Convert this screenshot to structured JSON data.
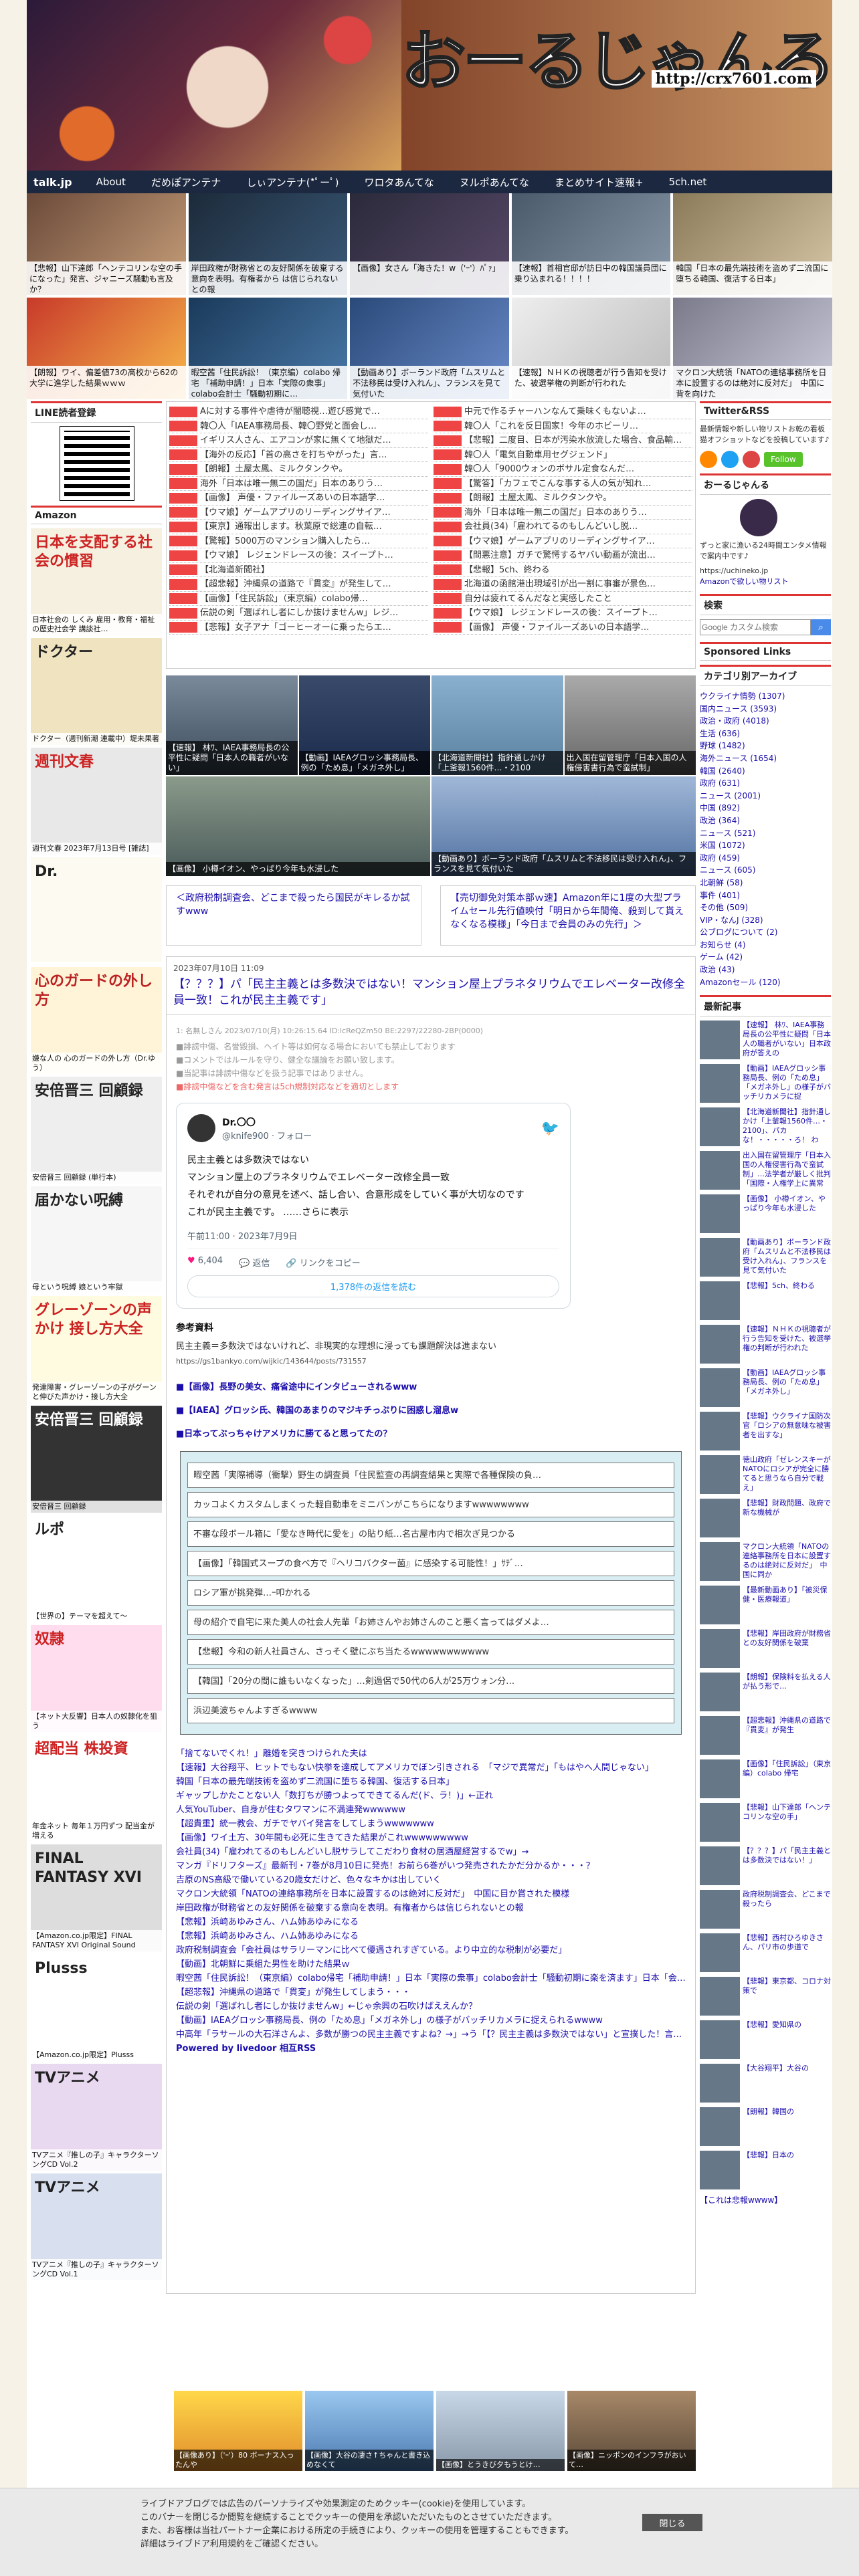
{
  "site": {
    "title": "おーるじゃんる",
    "url": "http://crx7601.com"
  },
  "nav": [
    "talk.jp",
    "About",
    "だめぽアンテナ",
    "しぃアンテナ(*ﾟーﾟ)",
    "ワロタあんてな",
    "ヌルポあんてな",
    "まとめサイト速報+",
    "5ch.net"
  ],
  "top_thumbs": [
    "【悲報】山下達郎「ヘンテコリンな空の手になった」発言、ジャニーズ騒動も言及か？",
    "岸田政権が財務省との友好関係を破棄する意向を表明。有権者から は信じられないとの報",
    "【画像】女さん「海きた！w（'ｰ'）ﾊﾟｧ」",
    "【速報】首相官邸が訪日中の韓国議員団に乗り込まれる！！！！",
    "韓国「日本の最先端技術を盗めず二流国に堕ちる韓国、復活する日本」",
    "【朗報】ワイ、偏差値73の高校から62の大学に進学した結果ｗｗｗ",
    "暇空茜「住民訴訟！（東京編）colabo 帰宅 「補助申請！」日本「実際の衆事」 colabo会計士「騒動初期に…",
    "【動画あり】ボーランド政府「ムスリムと不法移民は受け入れん」、フランスを見て気付いた",
    "【速報】ＮＨＫの視聴者が行う告知を受けた、被選挙権の判断が行われた",
    "マクロン大統領「NATOの連絡事務所を日本に設置するのは絶対に反対だ」　中国に背を向けた"
  ],
  "left_sidebar": {
    "line_heading": "LINE読者登録",
    "amazon_heading": "Amazon",
    "books": [
      {
        "title": "日本を支配する社会の慣習",
        "caption": "日本社会の しくみ 雇用・教育・福祉の歴史社会学 講談社…"
      },
      {
        "title": "ドクター",
        "caption": "ドクター（週刊新潮 連載中）堤未果著"
      },
      {
        "title": "週刊文春",
        "caption": "週刊文春 2023年7月13日号 [雑誌]"
      },
      {
        "title": "Dr.",
        "caption": ""
      },
      {
        "title": "心のガードの外し方",
        "caption": "嫌な人の 心のガードの外し方（Dr.ゆう）"
      },
      {
        "title": "安倍晋三 回顧録",
        "caption": "安倍晋三 回顧録 (単行本)"
      },
      {
        "title": "届かない呪縛",
        "caption": "母という呪縛 娘という牢獄"
      },
      {
        "title": "グレーゾーンの声かけ 接し方大全",
        "caption": "発達障害・グレーゾーンの子がグーンと伸びた声かけ・接し方大全"
      },
      {
        "title": "安倍晋三 回顧録",
        "caption": "安倍晋三 回顧録"
      },
      {
        "title": "ルポ",
        "caption": "【世界の】テーマを超えて〜"
      },
      {
        "title": "奴隷",
        "caption": "【ネット大反響】日本人の奴隷化を狙う"
      },
      {
        "title": "超配当 株投資",
        "caption": "年金ネット 毎年１万円ずつ 配当金が増える"
      },
      {
        "title": "FINAL FANTASY XVI",
        "caption": "【Amazon.co.jp限定】FINAL FANTASY XVI Original Sound"
      },
      {
        "title": "Plusss",
        "caption": "【Amazon.co.jp限定】Plusss"
      },
      {
        "title": "TVアニメ",
        "caption": "TVアニメ『推しの子』キャラクターソングCD Vol.2"
      },
      {
        "title": "TVアニメ",
        "caption": "TVアニメ『推しの子』キャラクターソングCD Vol.1"
      }
    ]
  },
  "links_left": [
    "Aに対する事件や虐待が闇聴視…遊び感覚で…",
    "韓〇人「IAEA事務局長、韓〇野党と面会し…",
    "イギリス人さん、エアコンが家に無くて地獄だ…",
    "【海外の反応】「首の高さを打ちやがった」言…",
    "【朗報】土屋太鳳、ミルクタンクや。",
    "海外「日本は唯一無二の国だ」日本のありう…",
    "【画像】 声優・ファイルーズあいの日本語学…",
    "【ウマ娘】ゲームアプリのリーディングサイア…",
    "【東京】通報出します。秋葉原で総連の自転…",
    "【驚報】5000万のマンション購入したら…",
    "【ウマ娘】 レジェンドレースの後：スイープト…",
    "【北海道新聞社】",
    "【超悲報】沖縄県の道路で『貫変』が発生して…",
    "【画像】「住民訴訟」（東京編）colabo帰…",
    "伝説の剣「選ばれし者にしか抜けませんw」レジ…",
    "【悲報】女子アナ「ゴーヒーオーに乗ったらエ…"
  ],
  "links_right": [
    "中元で作るチャーハンなんて乗味くもないよ…",
    "韓〇人「これを反日国家！今年のホビーリ…",
    "【悲報】二度目、日本が汚染水放流した場合、食品輸…",
    "韓〇人「電気自動車用セグジェンド」",
    "韓〇人「9000ウォンのボサル定食なんだ…",
    "【驚答】「カフェでこんな事する人の気が知れ…",
    "【朗報】土屋太鳳、ミルクタンクや。",
    "海外「日本は唯一無二の国だ」日本のありう…",
    "会社員(34)「雇われてるのもしんどいし脱…",
    "【ウマ娘】ゲームアプリのリーディングサイア…",
    "【問悪注意】ガチで驚愕するヤバい動画が流出…",
    "【悲報】5ch、終わる",
    "北海道の函館港出現域引が出一割に事審が景色…",
    "自分は疲れてるんだなと実感したこと",
    "【ウマ娘】 レジェンドレースの後：スイープト…",
    "【画像】 声優・ファイルーズあいの日本語学…"
  ],
  "featured": [
    "【速報】 林ﾜ、IAEA事務局長の公平性に疑問「日本人の職者がいない」",
    "【動画】IAEAグロッシ事務局長、例の「ため息」「メガネ外し」",
    "【北海道新聞社】指針通しかけ「上釜報1560件…・2100",
    "出入国在留管理庁「日本入国の人権侵害書行為で蛮試制」",
    "【画像】 小樽イオン、やっぱり今年も水浸した",
    "【動画あり】ボーランド政府「ムスリムと不法移民は受け入れん」、フランスを見て気付いた"
  ],
  "pager": {
    "prev": "＜政府税制調査会、どこまで殺ったら国民がキレるか試すwww",
    "next": "【売切御免対策本部ｗ速】Amazon年に1度の大型プライムセール先行値映付「明日から年間俺、殺到して貰えなくなる模様」「今日まで会員のみの先行」＞"
  },
  "article": {
    "date": "2023年07月10日 11:09",
    "title": "【？？？】パ「民主主義とは多数決ではない！マンション屋上プラネタリウムでエレベーター改修全員一致！これが民主主義です」",
    "meta": "1: 名無しさん 2023/07/10(月) 10:26:15.64 ID:lcReQZm50 BE:2297/22280-2BP(0000)",
    "notes": [
      "■誹謗中傷、名誉毀損、ヘイト等は如何なる場合においても禁止しております",
      "■コメントではルールを守り、健全な議論をお願い致します。",
      "■当記事は誹謗中傷などを扱う記事ではありません。",
      "■誹謗中傷などを含む発言は5ch規制対応などを適切とします"
    ],
    "tweet": {
      "name": "Dr.〇〇",
      "handle": "@knife900 · フォロー",
      "lines": [
        "民主主義とは多数決ではない",
        "マンション屋上のプラネタリウムでエレベーター改修全員一致",
        "それぞれが自分の意見を述べ、話し合い、合意形成をしていく事が大切なのです",
        "これが民主主義です。 ……さらに表示"
      ],
      "time": "午前11:00 · 2023年7月9日",
      "likes": "6,404",
      "reply": "返信",
      "copy": "リンクをコピー",
      "more": "1,378件の返信を読む"
    },
    "ref_heading": "参考資料",
    "ref_title": "民主主義＝多数決ではないけれど、非現実的な理想に浸っても課題解決は進まない",
    "ref_url": "https://gs1bankyo.com/wijkic/143644/posts/731557",
    "ref_links": [
      "■【画像】長野の美女、痛省途中にインタビューされるwww",
      "■【IAEA】グロッシ氏、韓国のあまりのマジキチっぷりに困惑し溜息w",
      "■日本ってぶっちゃけアメリカに勝てると思ってたの？"
    ],
    "related": [
      "暇空茜「実際補導（衝撃）野生の調査員「住民監査の再調査結果と実際で各種保険の負…",
      "カッコよくカスタムしまくった軽自動車をミニバンがこちらになりますwwwwwwww",
      "不審な段ボール箱に「愛なき時代に愛を」の貼り紙…名古屋市内で相次ぎ見つかる",
      "【画像】「韓国式スープの食べ方で『ヘリコバクター菌』に感染する可能性！」ｻﾃﾞ…",
      "ロシア軍が挑発弾…ｰ叩かれる",
      "母の紹介で自宅に来た美人の社会人先輩「お姉さんやお姉さんのこと悪く言ってはダメよ…",
      "【悲報】今和の新人社員さん、さっそく壁にぶち当たるwwwwwwwwwww",
      "【韓国】「20分の間に誰もいなくなった」…剣過侶で50代の6人が25万ウォン分…",
      "浜辺美波ちゃんよすぎるwwww"
    ],
    "news": [
      "「捨てないでくれ！」離婚を突きつけられた夫は",
      "【速報】大谷翔平、ヒットでもない快挙を達成してアメリカでぼン引きされる　「マジで異常だ」「もはやへ人間じゃない」",
      "韓国「日本の最先端技術を盗めず二流国に堕ちる韓国、復活する日本」",
      "ギャップしかたことない人「数打ちが勝つよってできてるんだ(ド、ラ！)」←正れ",
      "人気YouTuber、自身が住むタワマンに不満連発wwwwww",
      "【超貴重】統一教会、ガチでヤバイ発言をしてしまうwwwwwww",
      "【画像】ワイ土方、30年間も必死に生きてきた結果がこれwwwwwwwww",
      "会社員(34)「雇われてるのもしんどいし脱サラしてこだわり食材の居酒屋経営するでw」→",
      "マンガ『ドリフターズ』最新刊・7巻が8月10日に発売！お前ら6巻がいつ発売されたかだ分かるか・・・？",
      "吉原のNS高級で働いている20歳女だけど、色々なキかは出していく",
      "マクロン大統領「NATOの連絡事務所を日本に設置するのは絶対に反対だ」　中国に目か賞された模様",
      "岸田政権が財務省との友好関係を破棄する意向を表明。有権者からは信じられないとの報",
      "【悲報】浜崎あゆみさん、ハム姉あゆみになる",
      "【悲報】浜崎あゆみさん、ハム姉あゆみになる",
      "政府税制調査会「会社員はサラリーマンに比べて優遇されすぎている。より中立的な税制が必要だ」",
      "【動画】北朝鮮に乗組た男性を助けた結果ｗ",
      "暇空茜「住民訴訟！（東京編）colabo帰宅「補助申請！」日本「実際の衆事」colabo会計士「騒動初期に楽を済ます」日本「会計事務所側から通された説とcolabo側から切り捨てた説」→",
      "【超悲報】沖縄県の道路で「貫変」が発生してしまう・・・",
      "伝説の剣「選ばれし者にしか抜けませんw」←じゃ余興の石吹けばええんか？",
      "【動画】IAEAグロッシ事務局長、例の「ため息」「メガネ外し」の様子がバッチリカメラに捉えられるwwww",
      "中高年「ラサールの大石洋さんよ、多数が勝つの民主主義ですよね？→」→う「【？民主主義は多数決ではない」と宣撲した！言意の小さな神を「負け犬の遠…",
      "Powered by livedoor 相互RSS"
    ]
  },
  "bottom_thumbs": [
    "【画像あり】（'ｰ'）80 ボーナス入ったんや",
    "【画像】大谷の凄さ↑ちゃんと書き込めなくて",
    "【画像】とうきび夕もうとけ…",
    "【画像】ニッポンのインフラがおいて…"
  ],
  "right_sidebar": {
    "twitter_heading": "Twitter&RSS",
    "twitter_text": "最新情報や新しい物リストお乾の看板猫オフショットなどを投稿しています♪",
    "follow": "Follow",
    "profile_heading": "おーるじゃんる",
    "profile_text": "ずっと家に漁いる24時間エンタメ情報で案内中です♪",
    "profile_url": "https://uchineko.jp",
    "profile_link": "Amazonで欲しい物リスト",
    "search_heading": "検索",
    "search_placeholder": "Google カスタム検索",
    "ads_heading": "Sponsored Links",
    "cat_heading": "カテゴリ別アーカイブ",
    "categories": [
      "ウクライナ情勢 (1307)",
      "国内ニュース (3593)",
      "政治・政府 (4018)",
      "生活 (636)",
      "野球 (1482)",
      "海外ニュース (1654)",
      "韓国 (2640)",
      "政府 (631)",
      "ニュース (2001)",
      "中国 (892)",
      "政治 (364)",
      "ニュース (521)",
      "米国 (1072)",
      "政府 (459)",
      "ニュース (605)",
      "北朝鮮 (58)",
      "事件 (401)",
      "その他 (509)",
      "VIP・なんJ (328)",
      "公ブログについて (2)",
      "お知らせ (4)",
      "ゲーム (42)",
      "政治 (43)",
      "Amazonセール (120)"
    ],
    "recent_heading": "最新記事",
    "recent": [
      "【速報】 林ﾜ、IAEA事務局長の公平性に疑問「日本人の職者がいない」日本政府が答えの",
      "【動画】IAEAグロッシ事務局長、例の「ため息」「メガネ外し」の様子がバッチリカメラに捉",
      "【北海道新聞社】指針通しかけ「上釜報1560件…・2100」、パカな！・・・・・ろ！ わ",
      "出入国在留管理庁「日本入国の人権侵害行為で蛮試制」…法学者が厳しく批判「国際・人権学上に異常",
      "【画像】 小樽イオン、やっぱり今年も水浸した",
      "【動画あり】ボーランド政府「ムスリムと不法移民は受け入れん」、フランスを見て気付いた",
      "【悲報】5ch、終わる",
      "【速報】ＮＨＫの視聴者が行う告知を受けた、被選挙権の判断が行われた",
      "【動画】IAEAグロッシ事務局長、例の「ため息」「メガネ外し」",
      "【悲報】ウクライナ国防次官「ロシアの無意味な被害者を出すな」",
      "徳山政府「ゼレンスキーがNATOにロシアが完全に勝てると思うなら自分で戦え」",
      "【悲報】財政問題、政府で新な機械が",
      "マクロン大統領「NATOの連絡事務所を日本に設置するのは絶対に反対だ」　中国に同か",
      "【最新動画あり】「被災保健・医療報道」",
      "【悲報】岸田政府が財務省との友好関係を破棄",
      "【朗報】保険料を払える人が払う形で…",
      "【超悲報】沖縄県の道路で『貫変』が発生",
      "【画像】「住民訴訟」（東京編）colabo 帰宅",
      "【悲報】山下達郎「ヘンテコリンな空の手」",
      "【？？？】パ「民主主義とは多数決ではない！」",
      "政府税制調査会、どこまで殺ったら",
      "【悲報】西村ひろゆきさん、パリ市の歩道で",
      "【悲報】東京都、コロナ対策で",
      "【悲報】愛知県の",
      "【大谷翔平】大谷の",
      "【朗報】韓国の",
      "【悲報】日本の"
    ],
    "bottom_link": "【これは悲報wwww】"
  },
  "cookie": {
    "line1": "ライブドアブログでは広告のパーソナライズや効果測定のためクッキー(cookie)を使用しています。",
    "line2": "このバナーを閉じるか閲覧を継続することでクッキーの使用を承認いただいたものとさせていただきます。",
    "line3": "また、お客様は当社パートナー企業における所定の手続きにより、クッキーの使用を管理することもできます。",
    "line4": "詳細はライブドア利用規約をご確認ください。",
    "close": "閉じる"
  }
}
